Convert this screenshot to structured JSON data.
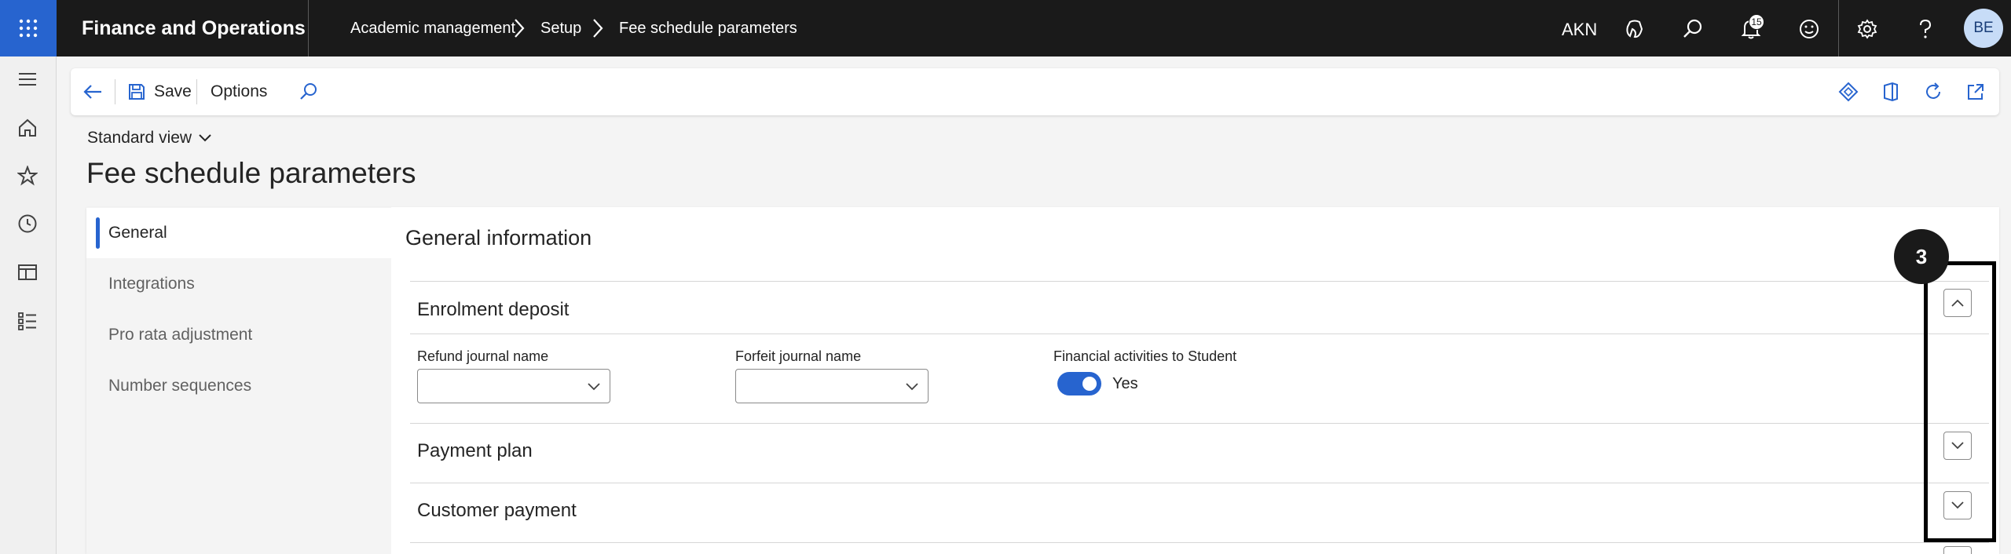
{
  "header": {
    "app_title": "Finance and Operations",
    "breadcrumbs": [
      "Academic management",
      "Setup",
      "Fee schedule parameters"
    ],
    "company": "AKN",
    "notification_count": "15",
    "avatar_initials": "BE",
    "icons": [
      "waffle-icon",
      "copilot-icon",
      "search-icon",
      "bell-icon",
      "smiley-icon",
      "gear-icon",
      "help-icon"
    ]
  },
  "rail": {
    "icons": [
      "hamburger-icon",
      "home-icon",
      "star-icon",
      "clock-icon",
      "workspace-icon",
      "modules-icon"
    ]
  },
  "action_pane": {
    "save_label": "Save",
    "options_label": "Options",
    "icons": [
      "back-icon",
      "save-icon",
      "search-icon",
      "diamond-icon",
      "office-icon",
      "refresh-icon",
      "popout-icon"
    ]
  },
  "view": {
    "selector_label": "Standard view"
  },
  "page": {
    "title": "Fee schedule parameters"
  },
  "tabs": [
    {
      "label": "General",
      "active": true
    },
    {
      "label": "Integrations",
      "active": false
    },
    {
      "label": "Pro rata adjustment",
      "active": false
    },
    {
      "label": "Number sequences",
      "active": false
    }
  ],
  "general": {
    "section_title": "General information",
    "fasttabs": [
      {
        "title": "Enrolment deposit",
        "expanded": true
      },
      {
        "title": "Payment plan",
        "expanded": false
      },
      {
        "title": "Customer payment",
        "expanded": false
      }
    ],
    "fields": {
      "refund_label": "Refund journal name",
      "refund_value": "",
      "forfeit_label": "Forfeit journal name",
      "forfeit_value": "",
      "financial_label": "Financial activities to Student",
      "financial_value": "Yes"
    }
  },
  "annotation": {
    "badge": "3"
  },
  "colors": {
    "accent": "#2764cf",
    "topbar": "#1a1a1a"
  }
}
